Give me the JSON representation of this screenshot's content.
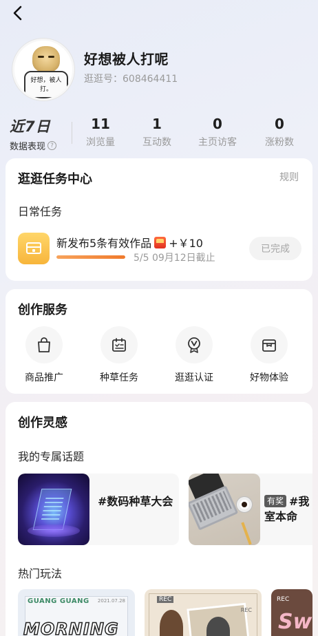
{
  "nav": {
    "back_icon": "back-arrow-icon"
  },
  "profile": {
    "nickname": "好想被人打呢",
    "user_id": "逛逛号：608464411",
    "avatar_caption": "好想，被人打。"
  },
  "stats": {
    "period_title": "近7日",
    "period_subtitle": "数据表现",
    "help_icon": "question-icon",
    "help_glyph": "?",
    "items": [
      {
        "value": "11",
        "label": "浏览量"
      },
      {
        "value": "1",
        "label": "互动数"
      },
      {
        "value": "0",
        "label": "主页访客"
      },
      {
        "value": "0",
        "label": "涨粉数"
      }
    ]
  },
  "task_center": {
    "title": "逛逛任务中心",
    "rules_link": "规则",
    "daily_label": "日常任务",
    "task": {
      "icon": "task-box-icon",
      "title": "新发布5条有效作品",
      "reward_icon": "red-packet-icon",
      "reward_text": "+￥10",
      "progress_fraction": 1.0,
      "progress_text": "5/5  09月12日截止",
      "status_button": "已完成"
    }
  },
  "creation_services": {
    "title": "创作服务",
    "items": [
      {
        "label": "商品推广",
        "icon": "shopping-bag-icon"
      },
      {
        "label": "种草任务",
        "icon": "calendar-task-icon"
      },
      {
        "label": "逛逛认证",
        "icon": "badge-v-icon"
      },
      {
        "label": "好物体验",
        "icon": "gift-box-icon"
      }
    ]
  },
  "inspiration": {
    "title": "创作灵感",
    "topics_label": "我的专属话题",
    "topics": [
      {
        "title": "#数码种草大会",
        "tag": ""
      },
      {
        "title": "#我的工作室本命",
        "line1": "#我",
        "line2": "室本命",
        "tag": "有奖"
      }
    ],
    "hot_label": "热门玩法",
    "hot_items": [
      {
        "brand": "GUANG GUANG",
        "date": "2021.07.28",
        "headline": "MORNING"
      },
      {
        "rec_label": "REC",
        "rec_label_2": "REC"
      },
      {
        "rec_label": "REC",
        "headline": "Sw"
      }
    ]
  },
  "colors": {
    "accent_orange": "#f07a2c",
    "task_icon_yellow": "#f7b53b",
    "muted_text": "#9a9a9a"
  }
}
